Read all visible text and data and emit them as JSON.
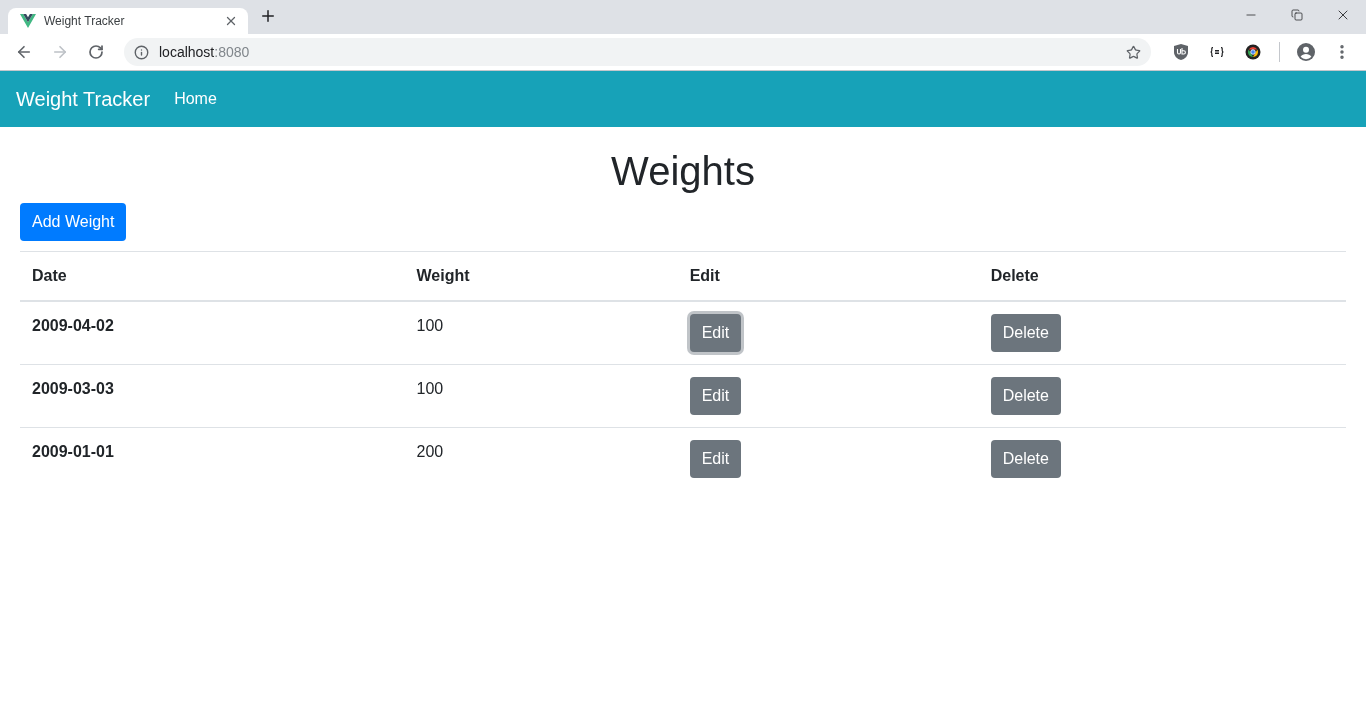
{
  "browser": {
    "tab": {
      "title": "Weight Tracker"
    },
    "back": {
      "disabled": false
    },
    "forward": {
      "disabled": true
    },
    "address": {
      "host": "localhost",
      "port": ":8080"
    }
  },
  "navbar": {
    "brand": "Weight Tracker",
    "links": [
      {
        "label": "Home"
      }
    ]
  },
  "page": {
    "heading": "Weights",
    "add_button": "Add Weight"
  },
  "table": {
    "columns": [
      "Date",
      "Weight",
      "Edit",
      "Delete"
    ],
    "rows": [
      {
        "date": "2009-04-02",
        "weight": "100",
        "edit": {
          "label": "Edit",
          "focused": true
        },
        "delete": {
          "label": "Delete",
          "focused": false
        }
      },
      {
        "date": "2009-03-03",
        "weight": "100",
        "edit": {
          "label": "Edit",
          "focused": false
        },
        "delete": {
          "label": "Delete",
          "focused": false
        }
      },
      {
        "date": "2009-01-01",
        "weight": "200",
        "edit": {
          "label": "Edit",
          "focused": false
        },
        "delete": {
          "label": "Delete",
          "focused": false
        }
      }
    ]
  }
}
